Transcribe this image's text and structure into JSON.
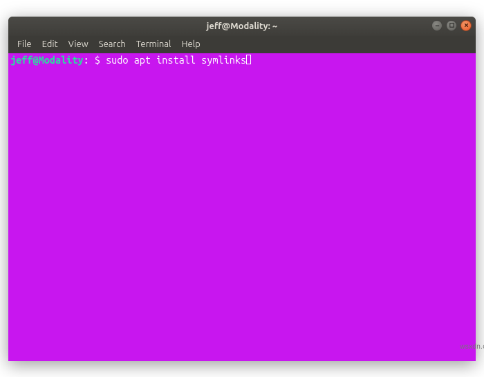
{
  "window": {
    "title": "jeff@Modality: ~"
  },
  "menu": {
    "items": [
      "File",
      "Edit",
      "View",
      "Search",
      "Terminal",
      "Help"
    ]
  },
  "terminal": {
    "prompt_user_host": "jeff@Modality",
    "prompt_sep": ": ",
    "prompt_dollar_and_space": "$ ",
    "command": "sudo apt install symlinks"
  },
  "watermark": "wsxdn.com",
  "colors": {
    "terminal_bg": "#c816ef",
    "prompt_user": "#2bdca0",
    "close_button": "#e95420"
  }
}
